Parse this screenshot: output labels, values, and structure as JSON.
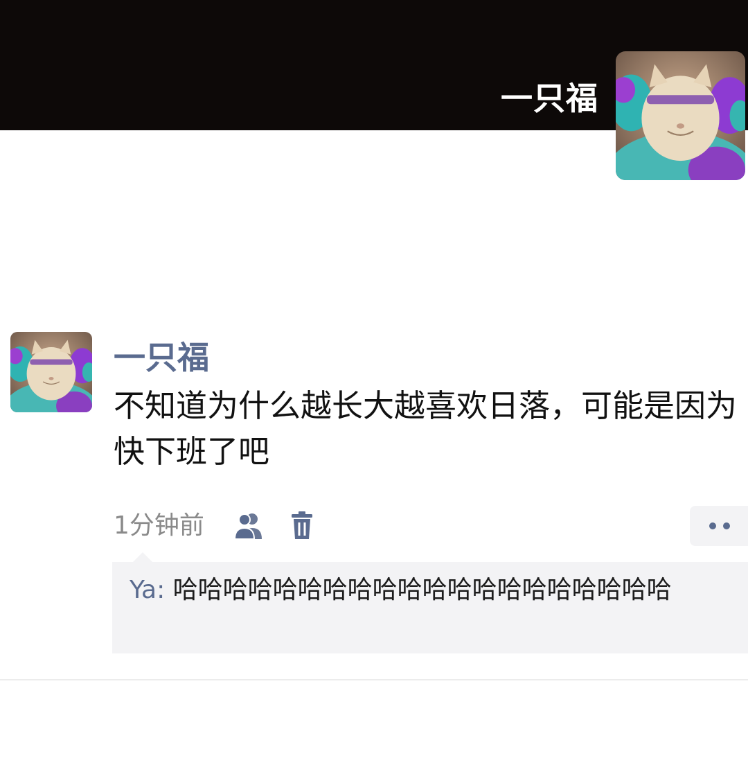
{
  "cover": {
    "username": "一只福"
  },
  "post": {
    "username": "一只福",
    "text": "不知道为什么越长大越喜欢日落，可能是因为快下班了吧",
    "timestamp": "1分钟前"
  },
  "comment": {
    "author": "Ya",
    "separator": ": ",
    "text": "哈哈哈哈哈哈哈哈哈哈哈哈哈哈哈哈哈哈哈哈"
  },
  "colors": {
    "cover_background": "#0d0908",
    "name_link": "#5a6b8f",
    "comment_background": "#f3f3f5"
  },
  "icons": {
    "friends": "friends-icon",
    "delete": "trash-icon",
    "more": "more-dots-icon"
  }
}
